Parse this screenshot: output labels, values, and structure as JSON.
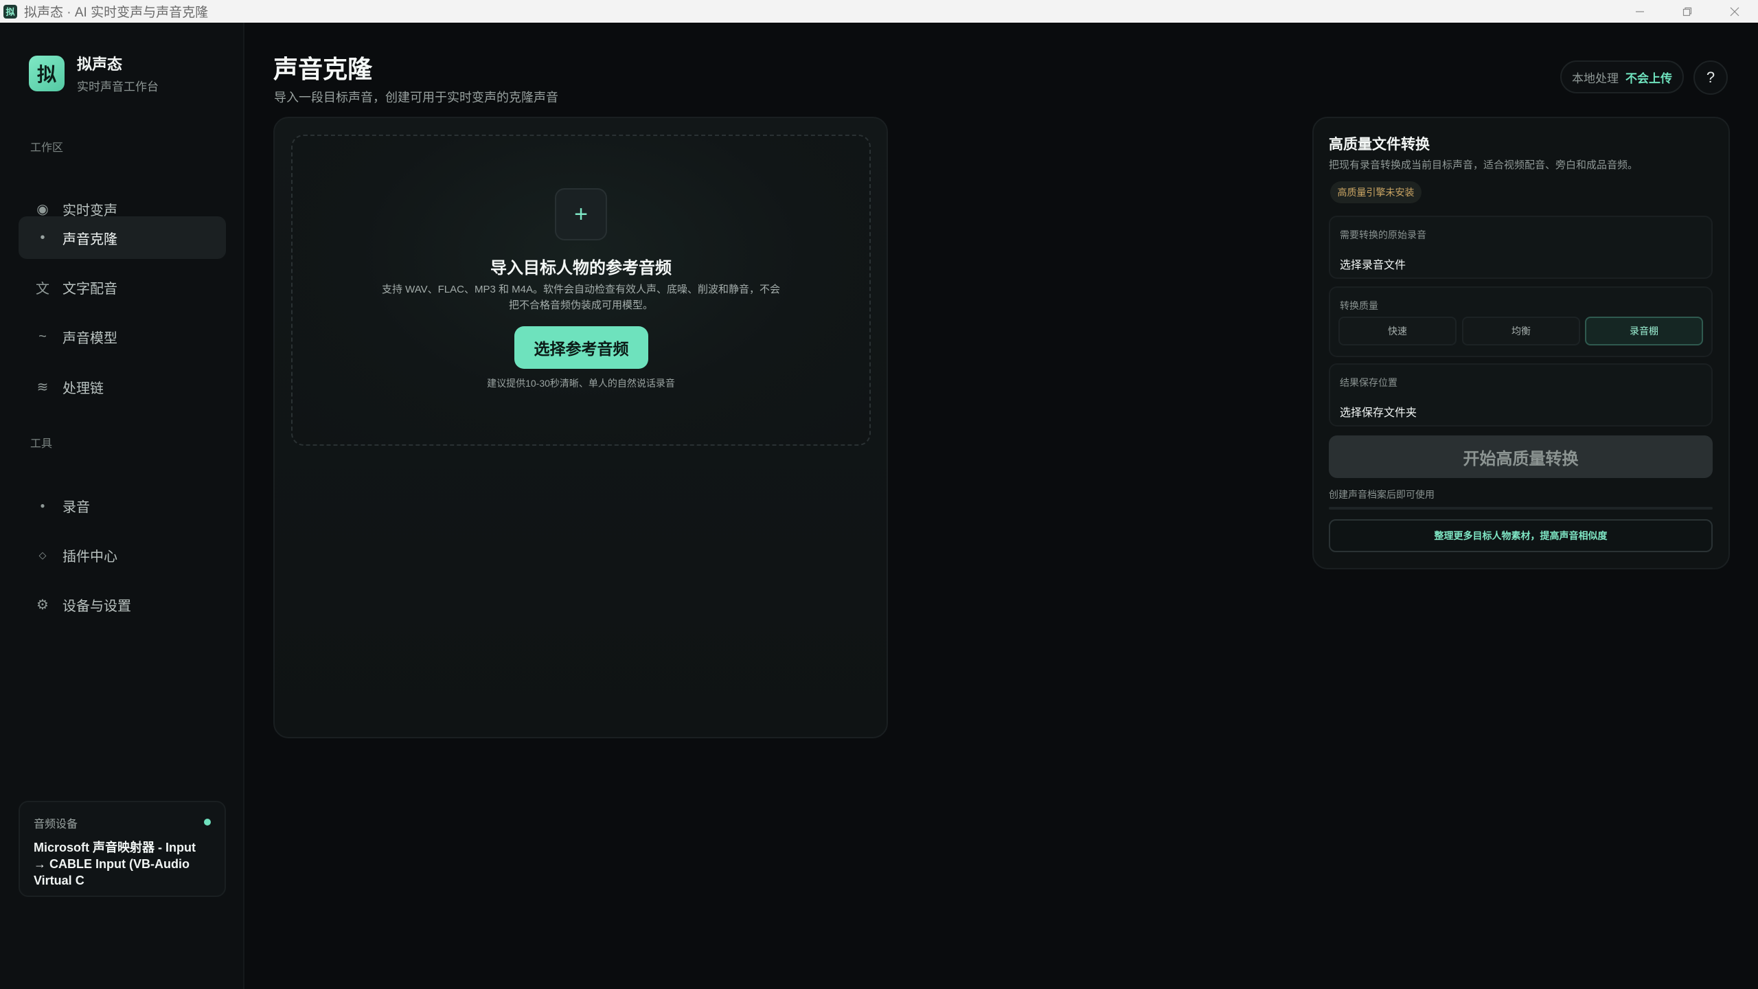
{
  "window": {
    "title": "拟声态 · AI 实时变声与声音克隆",
    "icon": "app-icon",
    "controls": [
      "minimize-icon",
      "restore-icon",
      "close-icon"
    ]
  },
  "brand": {
    "logo_char": "拟",
    "name": "拟声态",
    "subtitle": "实时声音工作台"
  },
  "sidebar": {
    "workspace_label": "工作区",
    "workspace_items": [
      {
        "label": "实时变声",
        "icon": "◉",
        "icon_name": "record-icon"
      },
      {
        "label": "声音克隆",
        "icon": "•",
        "icon_name": "dot-icon",
        "active": true
      },
      {
        "label": "文字配音",
        "icon": "文",
        "icon_name": "text-icon"
      },
      {
        "label": "声音模型",
        "icon": "~",
        "icon_name": "wave-icon"
      },
      {
        "label": "处理链",
        "icon": "≋",
        "icon_name": "chain-icon"
      }
    ],
    "tools_label": "工具",
    "tools_items": [
      {
        "label": "录音",
        "icon": "●",
        "icon_name": "mic-dot-icon"
      },
      {
        "label": "插件中心",
        "icon": "◇",
        "icon_name": "plugin-icon"
      },
      {
        "label": "设备与设置",
        "icon": "⚙",
        "icon_name": "gear-icon"
      }
    ],
    "device": {
      "label": "音频设备",
      "name": "Microsoft 声音映射器 - Input → CABLE Input (VB-Audio Virtual C",
      "status_color": "#6fe0bd"
    }
  },
  "header": {
    "title": "声音克隆",
    "subtitle": "导入一段目标声音，创建可用于实时变声的克隆声音",
    "privacy_muted": "本地处理",
    "privacy_accent": "不会上传",
    "help": "?"
  },
  "import": {
    "plus": "+",
    "title": "导入目标人物的参考音频",
    "desc": "支持 WAV、FLAC、MP3 和 M4A。软件会自动检查有效人声、底噪、削波和静音，不会把不合格音频伪装成可用模型。",
    "button": "选择参考音频",
    "hint": "建议提供10-30秒清晰、单人的自然说话录音"
  },
  "convert": {
    "title": "高质量文件转换",
    "subtitle": "把现有录音转换成当前目标声音，适合视频配音、旁白和成品音频。",
    "badge": "高质量引擎未安装",
    "source_label": "需要转换的原始录音",
    "source_value": "选择录音文件",
    "quality_label": "转换质量",
    "quality_options": [
      "快速",
      "均衡",
      "录音棚"
    ],
    "quality_selected": "录音棚",
    "save_label": "结果保存位置",
    "save_value": "选择保存文件夹",
    "start_button": "开始高质量转换",
    "start_hint": "创建声音档案后即可使用",
    "progress": 0,
    "more_button": "整理更多目标人物素材，提高声音相似度"
  },
  "colors": {
    "accent": "#6ee2bd",
    "background": "#0a0c0e",
    "panel": "#0f1314",
    "warning_text": "#c9a463"
  }
}
